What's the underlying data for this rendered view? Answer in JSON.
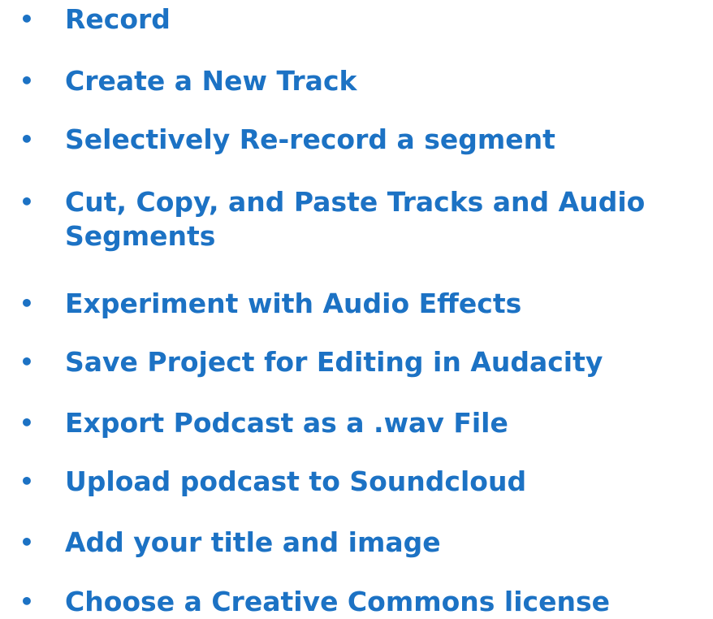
{
  "colors": {
    "text": "#1C72C4",
    "background": "#FFFFFF"
  },
  "bullet_symbol": "•",
  "items": [
    "Record",
    "Create a New Track",
    "Selectively Re-record a segment",
    "Cut, Copy, and Paste Tracks and Audio Segments",
    "Experiment with  Audio Effects",
    "Save Project for Editing in Audacity",
    "Export Podcast as a .wav File",
    "Upload podcast to Soundcloud",
    "Add your title and image",
    "Choose a Creative Commons license"
  ]
}
